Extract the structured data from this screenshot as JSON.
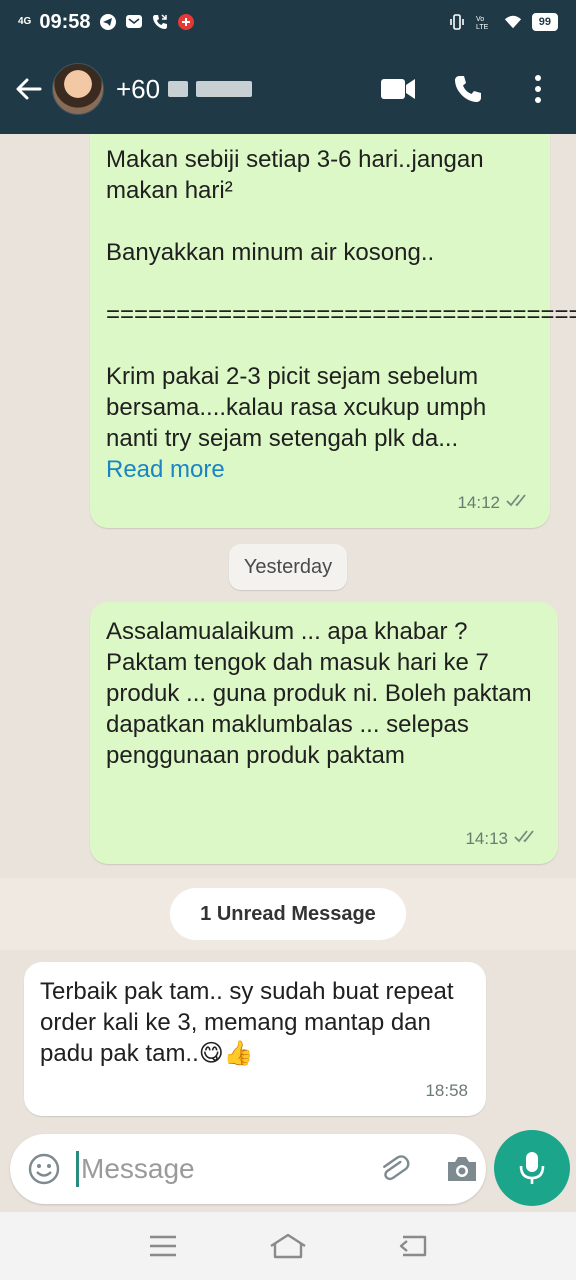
{
  "status_bar": {
    "network": "4G",
    "time": "09:58",
    "battery": "99",
    "icons": [
      "telegram-icon",
      "message-icon",
      "missed-call-icon",
      "notification-icon",
      "vibrate-icon",
      "volte-icon",
      "wifi-icon",
      "battery-icon"
    ]
  },
  "header": {
    "contact_prefix": "+60",
    "icons": [
      "back-arrow-icon",
      "video-call-icon",
      "voice-call-icon",
      "more-vert-icon"
    ]
  },
  "messages": [
    {
      "direction": "outgoing",
      "text": "Makan sebiji setiap 3-6 hari..jangan makan hari²\n\nBanyakkan minum air kosong..\n\n==============================================\n\nKrim pakai 2-3 picit sejam sebelum bersama....kalau rasa xcukup umph nanti try sejam setengah plk da...",
      "read_more": "Read more",
      "time": "14:12"
    },
    {
      "direction": "outgoing",
      "text": "Assalamualaikum ... apa khabar ? Paktam tengok dah masuk hari ke 7 produk ... guna produk ni. Boleh paktam dapatkan maklumbalas ... selepas penggunaan produk paktam",
      "time": "14:13"
    },
    {
      "direction": "incoming",
      "text": "Terbaik pak tam.. sy sudah buat repeat order kali ke 3, memang mantap dan padu pak tam..😋👍",
      "time": "18:58"
    }
  ],
  "date_separator": "Yesterday",
  "unread_label": "1 Unread Message",
  "composer": {
    "placeholder": "Message"
  },
  "colors": {
    "header_bg": "#1f3a46",
    "outgoing_bubble": "#dcf8c6",
    "incoming_bubble": "#ffffff",
    "chat_bg": "#e9e3dc",
    "mic_button": "#1ba58b",
    "link": "#1a85c6"
  }
}
